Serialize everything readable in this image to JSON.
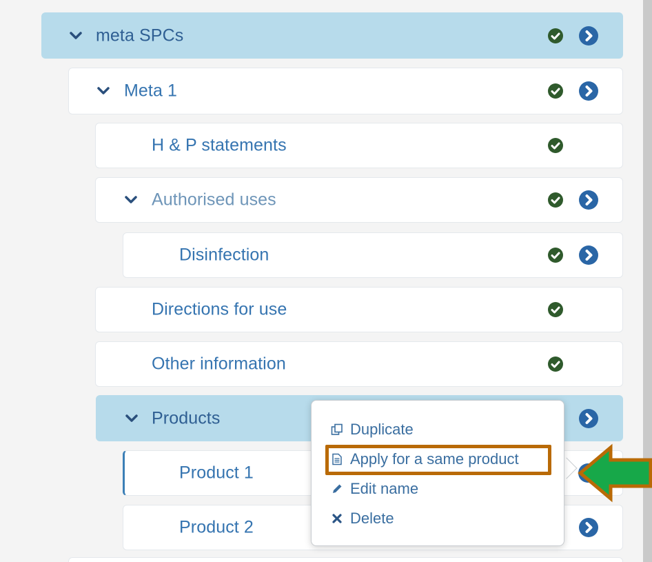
{
  "tree": {
    "meta_spcs": {
      "label": "meta SPCs"
    },
    "meta_1": {
      "label": "Meta 1"
    },
    "hp_statements": {
      "label": "H & P statements"
    },
    "authorised_uses": {
      "label": "Authorised uses"
    },
    "disinfection": {
      "label": "Disinfection"
    },
    "directions_for_use": {
      "label": "Directions for use"
    },
    "other_information": {
      "label": "Other information"
    },
    "products": {
      "label": "Products"
    },
    "product_1": {
      "label": "Product 1"
    },
    "product_2": {
      "label": "Product 2"
    }
  },
  "context_menu": {
    "duplicate": "Duplicate",
    "apply_same_product": "Apply for a same product",
    "edit_name": "Edit name",
    "delete": "Delete"
  },
  "icons": {
    "expanded": "chevron-down-icon",
    "valid": "check-circle-icon",
    "navigate": "chevron-right-circle-icon",
    "duplicate": "copy-icon",
    "apply": "document-icon",
    "edit": "pencil-icon",
    "delete": "times-icon"
  },
  "colors": {
    "selected_row": "#b7dbeb",
    "text": "#3574b0",
    "check": "#2f5a2c",
    "navigate": "#2a66a6",
    "highlight": "#b96a06",
    "arrow": "#17a849"
  }
}
